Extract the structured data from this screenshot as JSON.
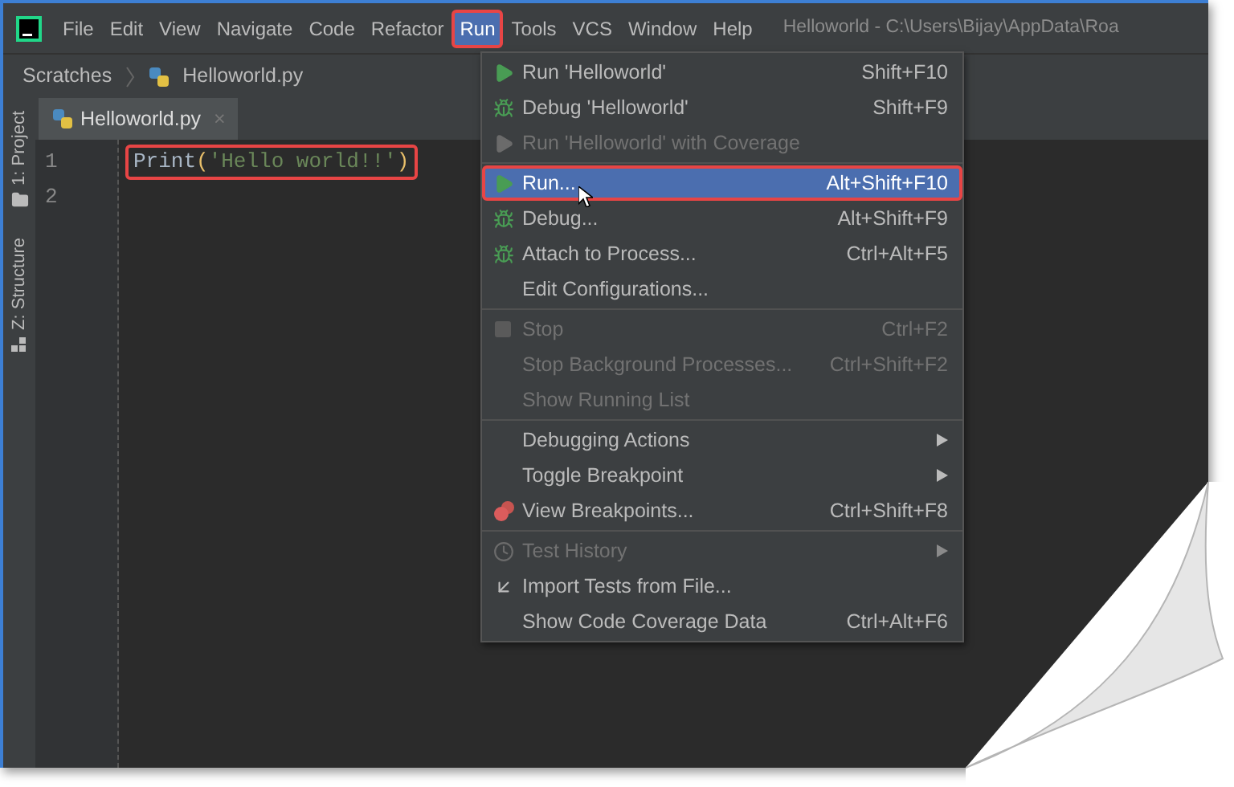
{
  "menu_bar": [
    {
      "label": "File",
      "selected": false
    },
    {
      "label": "Edit",
      "selected": false
    },
    {
      "label": "View",
      "selected": false
    },
    {
      "label": "Navigate",
      "selected": false
    },
    {
      "label": "Code",
      "selected": false
    },
    {
      "label": "Refactor",
      "selected": false
    },
    {
      "label": "Run",
      "selected": true,
      "highlighted": true
    },
    {
      "label": "Tools",
      "selected": false
    },
    {
      "label": "VCS",
      "selected": false
    },
    {
      "label": "Window",
      "selected": false
    },
    {
      "label": "Help",
      "selected": false
    }
  ],
  "window": {
    "title": "Helloworld - C:\\Users\\Bijay\\AppData\\Roa"
  },
  "breadcrumb": [
    "Scratches",
    "Helloworld.py"
  ],
  "tool_strip": [
    {
      "label": "1: Project",
      "kind": "project"
    },
    {
      "label": "Z: Structure",
      "kind": "structure"
    }
  ],
  "tabs": [
    {
      "label": "Helloworld.py",
      "selected": true,
      "close": "×"
    }
  ],
  "editor": {
    "lines": [
      {
        "number": "1",
        "highlighted": true,
        "tokens": [
          {
            "text": "Print",
            "kind": "plain"
          },
          {
            "text": "(",
            "kind": "paren"
          },
          {
            "text": "'Hello world!!'",
            "kind": "string"
          },
          {
            "text": ")",
            "kind": "paren"
          }
        ]
      },
      {
        "number": "2"
      }
    ]
  },
  "run_menu": [
    {
      "kind": "run",
      "label": "Run 'Helloworld'",
      "shortcut": "Shift+F10",
      "disabled": false,
      "selected": false
    },
    {
      "kind": "debug",
      "label": "Debug 'Helloworld'",
      "shortcut": "Shift+F9",
      "disabled": false,
      "selected": false
    },
    {
      "kind": "coverage",
      "label": "Run 'Helloworld' with Coverage",
      "disabled": true,
      "selected": false
    },
    {
      "kind": "separator"
    },
    {
      "kind": "run",
      "label": "Run...",
      "shortcut": "Alt+Shift+F10",
      "disabled": false,
      "selected": true,
      "highlighted": true
    },
    {
      "kind": "debug",
      "label": "Debug...",
      "shortcut": "Alt+Shift+F9",
      "disabled": false,
      "selected": false
    },
    {
      "kind": "attach",
      "label": "Attach to Process...",
      "shortcut": "Ctrl+Alt+F5",
      "disabled": false,
      "selected": false
    },
    {
      "kind": "plain",
      "label": "Edit Configurations...",
      "disabled": false,
      "selected": false
    },
    {
      "kind": "separator"
    },
    {
      "kind": "stop",
      "label": "Stop",
      "shortcut": "Ctrl+F2",
      "disabled": true,
      "selected": false
    },
    {
      "kind": "plain",
      "label": "Stop Background Processes...",
      "shortcut": "Ctrl+Shift+F2",
      "disabled": true,
      "selected": false
    },
    {
      "kind": "plain",
      "label": "Show Running List",
      "disabled": true,
      "selected": false
    },
    {
      "kind": "separator"
    },
    {
      "kind": "plain",
      "label": "Debugging Actions",
      "submenu": true,
      "disabled": false,
      "selected": false
    },
    {
      "kind": "plain",
      "label": "Toggle Breakpoint",
      "submenu": true,
      "disabled": false,
      "selected": false
    },
    {
      "kind": "breakpoints",
      "label": "View Breakpoints...",
      "shortcut": "Ctrl+Shift+F8",
      "disabled": false,
      "selected": false
    },
    {
      "kind": "separator"
    },
    {
      "kind": "history",
      "label": "Test History",
      "submenu": true,
      "disabled": true,
      "selected": false
    },
    {
      "kind": "import",
      "label": "Import Tests from File...",
      "disabled": false,
      "selected": false
    },
    {
      "kind": "plain",
      "label": "Show Code Coverage Data",
      "shortcut": "Ctrl+Alt+F6",
      "disabled": false,
      "selected": false
    }
  ]
}
